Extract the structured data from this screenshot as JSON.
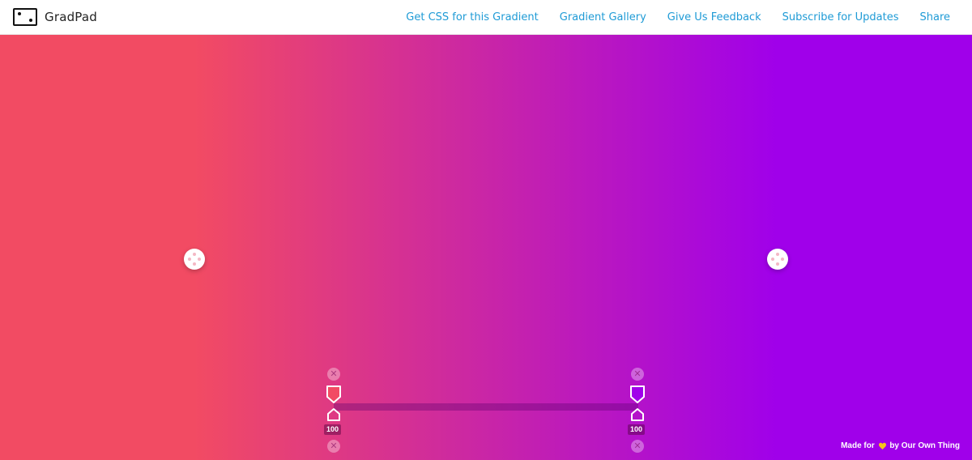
{
  "header": {
    "brand": "GradPad",
    "nav": [
      {
        "label": "Get CSS for this Gradient"
      },
      {
        "label": "Gradient Gallery"
      },
      {
        "label": "Give Us Feedback"
      },
      {
        "label": "Subscribe for Updates"
      },
      {
        "label": "Share"
      }
    ]
  },
  "gradient": {
    "start_color": "#f24b63",
    "end_color": "#a000ea"
  },
  "stops": [
    {
      "top_color": "#f24b63",
      "opacity_label": "100"
    },
    {
      "top_color": "#a000ea",
      "opacity_label": "100"
    }
  ],
  "footer": {
    "made_for": "Made for",
    "by": "by Our Own Thing"
  },
  "icons": {
    "logo": "gradpad-logo-icon",
    "remove": "close-icon",
    "footer_symbol": "heart-icon"
  }
}
